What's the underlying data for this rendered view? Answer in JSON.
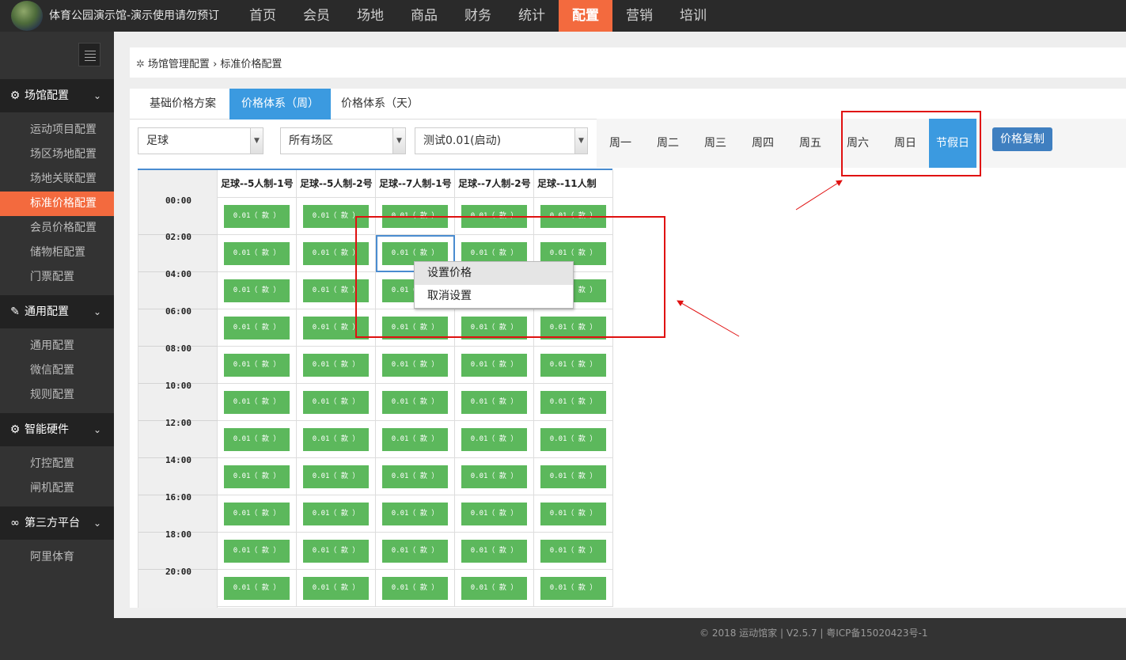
{
  "header": {
    "site_title": "体育公园演示馆-演示使用请勿预订",
    "nav": [
      "首页",
      "会员",
      "场地",
      "商品",
      "财务",
      "统计",
      "配置",
      "营销",
      "培训"
    ],
    "active_nav": "配置"
  },
  "sidebar": {
    "groups": [
      {
        "label": "场馆配置",
        "icon": "cogs-icon",
        "items": [
          "运动项目配置",
          "场区场地配置",
          "场地关联配置",
          "标准价格配置",
          "会员价格配置",
          "储物柜配置",
          "门票配置"
        ]
      },
      {
        "label": "通用配置",
        "icon": "wrench-icon",
        "items": [
          "通用配置",
          "微信配置",
          "规则配置"
        ]
      },
      {
        "label": "智能硬件",
        "icon": "gear-icon",
        "items": [
          "灯控配置",
          "闸机配置"
        ]
      },
      {
        "label": "第三方平台",
        "icon": "handshake-icon",
        "items": [
          "阿里体育"
        ]
      }
    ],
    "active_item": "标准价格配置"
  },
  "breadcrumb": {
    "parent": "场馆管理配置",
    "separator": "›",
    "current": "标准价格配置"
  },
  "tabs": [
    "基础价格方案",
    "价格体系（周）",
    "价格体系（天）"
  ],
  "active_tab": "价格体系（周）",
  "filters": {
    "sport": "足球",
    "area": "所有场区",
    "plan": "测试0.01(启动)"
  },
  "days": [
    "周一",
    "周二",
    "周三",
    "周四",
    "周五",
    "周六",
    "周日",
    "节假日"
  ],
  "active_day": "节假日",
  "copy_button": "价格复制",
  "grid": {
    "columns": [
      "足球--5人制-1号",
      "足球--5人制-2号",
      "足球--7人制-1号",
      "足球--7人制-2号",
      "足球--11人制"
    ],
    "times": [
      "00:00",
      "02:00",
      "04:00",
      "06:00",
      "08:00",
      "10:00",
      "12:00",
      "14:00",
      "16:00",
      "18:00",
      "20:00"
    ],
    "cell_text": "0.01（ 款 ）",
    "cell_color": "#5cb85c"
  },
  "context_menu": {
    "items": [
      "设置价格",
      "取消设置"
    ]
  },
  "footer": "© 2018 运动馆家 | V2.5.7 | 粤ICP备15020423号-1",
  "colors": {
    "accent": "#f36a3e",
    "active_blue": "#3b9ae0",
    "annotation_red": "#e01010"
  }
}
